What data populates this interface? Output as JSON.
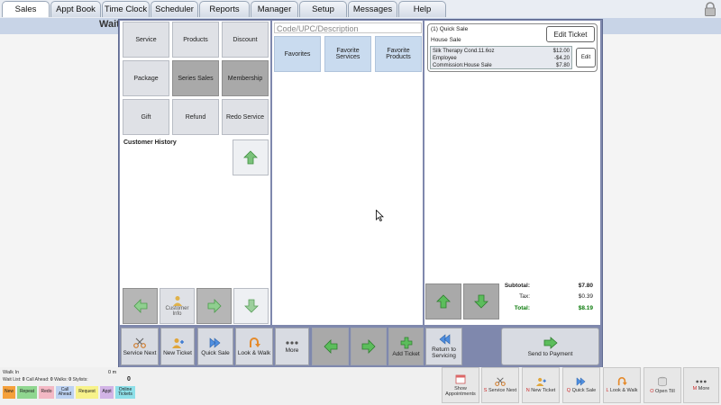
{
  "nav": {
    "tabs": [
      "Sales",
      "Appt Book",
      "Time Clock",
      "Scheduler",
      "Reports",
      "Manager",
      "Setup",
      "Messages",
      "Help"
    ],
    "active": "Sales"
  },
  "background_title": "Wait",
  "left_grid": {
    "buttons": [
      "Service",
      "Products",
      "Discount",
      "Package",
      "Series Sales",
      "Membership",
      "Gift",
      "Refund",
      "Redo Service"
    ]
  },
  "customer_history_label": "Customer History",
  "customer_info_label": "Customer Info",
  "search": {
    "placeholder": "Code/UPC/Description"
  },
  "favorites": [
    "Favorites",
    "Favorite Services",
    "Favorite Products"
  ],
  "ticket": {
    "title": "(1) Quick Sale",
    "edit_ticket_label": "Edit Ticket",
    "house_sale": "House Sale",
    "lines": [
      {
        "label": "Silk Therapy Cond.11.6oz",
        "value": "$12.00"
      },
      {
        "label": "Employee",
        "value": "-$4.20"
      },
      {
        "label": "Commission:House Sale",
        "value": "$7.80"
      }
    ],
    "edit_label": "Edit"
  },
  "totals": {
    "subtotal_label": "Subtotal:",
    "subtotal": "$7.80",
    "tax_label": "Tax:",
    "tax": "$0.39",
    "total_label": "Total:",
    "total": "$8.19"
  },
  "actions": {
    "service_next": "Service Next",
    "new_ticket": "New Ticket",
    "quick_sale": "Quick Sale",
    "look_walk": "Look & Walk",
    "more": "More",
    "add_ticket": "Add Ticket",
    "return_servicing": "Return to Servicing",
    "send_payment": "Send to Payment"
  },
  "footer": {
    "walk_in": "Walk In",
    "minutes": "0 m",
    "wait_list_label": "Wait List:",
    "wait_list": "0",
    "call_ahead_label": "Call Ahead:",
    "call_ahead": "0",
    "walks_label": "Walks:",
    "walks": "0",
    "stylists_label": "Stylists:",
    "count": "0",
    "chips": [
      "New",
      "Repeat",
      "Redo",
      "Call Ahead",
      "Request",
      "Appt",
      "Online Tickets"
    ],
    "buttons": [
      {
        "key": "",
        "label": "Show Appointments"
      },
      {
        "key": "S",
        "label": "Service Next"
      },
      {
        "key": "N",
        "label": "New Ticket"
      },
      {
        "key": "Q",
        "label": "Quick Sale"
      },
      {
        "key": "L",
        "label": "Look & Walk"
      },
      {
        "key": "O",
        "label": "Open Till"
      },
      {
        "key": "M",
        "label": "More"
      }
    ]
  },
  "colors": {
    "dialog_bg": "#7f88ad",
    "accent_green": "#34a534",
    "total_green": "#0a7a0a",
    "nav_bg": "#e9edf3"
  }
}
